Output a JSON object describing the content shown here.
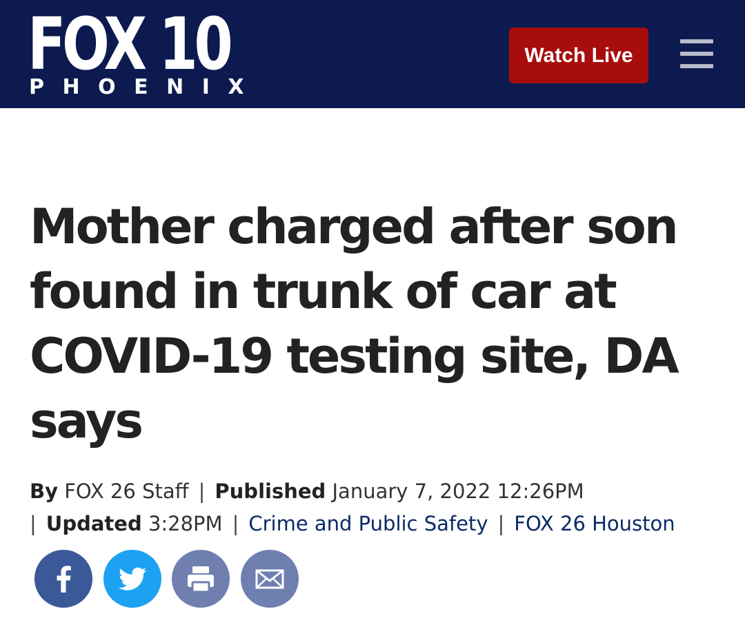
{
  "header": {
    "logo_main": "FOX 10",
    "logo_sub": "PHOENIX",
    "watch_live_label": "Watch Live",
    "menu_icon": "hamburger-menu-icon",
    "background_color": "#0c1a50",
    "watch_live_color": "#a80d0d"
  },
  "article": {
    "headline": "Mother charged after son found in trunk of car at COVID-19 testing site, DA says",
    "meta": {
      "by_label": "By",
      "author": "FOX 26 Staff",
      "separator": "|",
      "published_label": "Published",
      "published_date": "January 7, 2022 12:26PM",
      "updated_label": "Updated",
      "updated_time": "3:28PM",
      "category": "Crime and Public Safety",
      "source": "FOX 26 Houston"
    }
  },
  "share": {
    "buttons": [
      {
        "icon": "facebook-icon",
        "color": "#3b5998"
      },
      {
        "icon": "twitter-icon",
        "color": "#1da1f2"
      },
      {
        "icon": "print-icon",
        "color": "#6f7fb0"
      },
      {
        "icon": "email-icon",
        "color": "#6f7fb0"
      }
    ]
  }
}
